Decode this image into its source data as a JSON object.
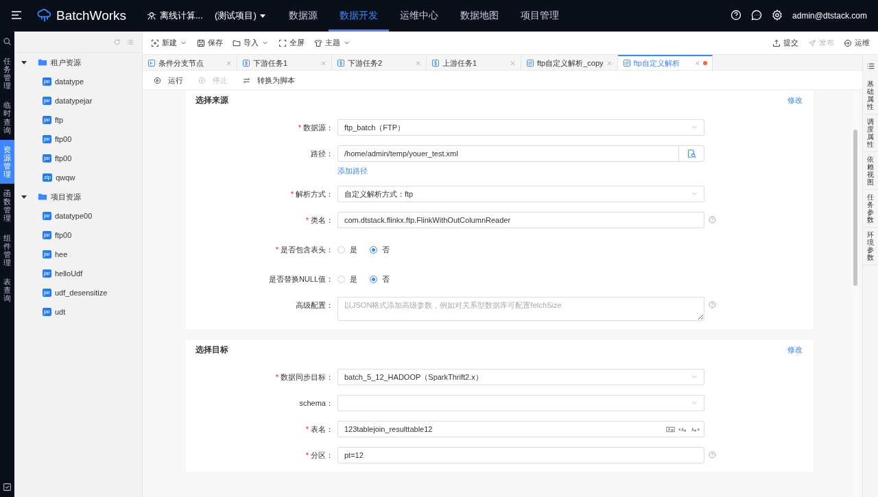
{
  "header": {
    "brand": "BatchWorks",
    "project": "离线计算...",
    "project_tag": "(测试项目)",
    "nav": [
      {
        "label": "数据源",
        "selected": false
      },
      {
        "label": "数据开发",
        "selected": true
      },
      {
        "label": "运维中心",
        "selected": false
      },
      {
        "label": "数据地图",
        "selected": false
      },
      {
        "label": "项目管理",
        "selected": false
      }
    ],
    "user": "admin@dtstack.com"
  },
  "rail": {
    "items": [
      {
        "label": "任务管理",
        "selected": false
      },
      {
        "label": "临时查询",
        "selected": false
      },
      {
        "label": "资源管理",
        "selected": true
      },
      {
        "label": "函数管理",
        "selected": false
      },
      {
        "label": "组件管理",
        "selected": false
      },
      {
        "label": "表查询",
        "selected": false
      }
    ]
  },
  "tree": [
    {
      "label": "租户资源",
      "expanded": true,
      "children": [
        {
          "label": "datatype",
          "badge": "jar"
        },
        {
          "label": "datatypejar",
          "badge": "jar"
        },
        {
          "label": "ftp",
          "badge": "jar"
        },
        {
          "label": "ftp00",
          "badge": "jar"
        },
        {
          "label": "ftp00",
          "badge": "jar"
        },
        {
          "label": "qwqw",
          "badge": "zip"
        }
      ]
    },
    {
      "label": "项目资源",
      "expanded": true,
      "children": [
        {
          "label": "datatype00",
          "badge": "jar"
        },
        {
          "label": "ftp00",
          "badge": "jar"
        },
        {
          "label": "hee",
          "badge": "jar"
        },
        {
          "label": "helloUdf",
          "badge": "jar"
        },
        {
          "label": "udf_desensitize",
          "badge": "jar"
        },
        {
          "label": "udt",
          "badge": "jar"
        }
      ]
    }
  ],
  "toolbar": {
    "left": [
      {
        "label": "新建",
        "kind": "new",
        "dropdown": true,
        "disabled": false
      },
      {
        "label": "保存",
        "kind": "save",
        "dropdown": false,
        "disabled": false
      },
      {
        "label": "导入",
        "kind": "import",
        "dropdown": true,
        "disabled": false
      },
      {
        "label": "全屏",
        "kind": "fullscreen",
        "dropdown": false,
        "disabled": false
      },
      {
        "label": "主题",
        "kind": "theme",
        "dropdown": true,
        "disabled": false
      }
    ],
    "right": [
      {
        "label": "提交",
        "kind": "submit",
        "dropdown": false,
        "disabled": false
      },
      {
        "label": "发布",
        "kind": "publish",
        "dropdown": false,
        "disabled": true
      },
      {
        "label": "运维",
        "kind": "ops",
        "dropdown": false,
        "disabled": false
      }
    ]
  },
  "tabs": [
    {
      "label": "条件分支节点",
      "kind": "branch",
      "selected": false,
      "modified": false
    },
    {
      "label": "下游任务1",
      "kind": "sql",
      "selected": false,
      "modified": false
    },
    {
      "label": "下游任务2",
      "kind": "sql",
      "selected": false,
      "modified": false
    },
    {
      "label": "上游任务1",
      "kind": "sql",
      "selected": false,
      "modified": false
    },
    {
      "label": "ftp自定义解析_copy",
      "kind": "sync",
      "selected": false,
      "modified": false
    },
    {
      "label": "ftp自定义解析",
      "kind": "sync",
      "selected": true,
      "modified": true
    }
  ],
  "runbar": [
    {
      "label": "运行",
      "kind": "run",
      "disabled": false
    },
    {
      "label": "停止",
      "kind": "stop",
      "disabled": true
    },
    {
      "label": "转换为脚本",
      "kind": "convert",
      "disabled": false
    }
  ],
  "side_tabs": [
    "基础属性",
    "调度属性",
    "依赖视图",
    "任务参数",
    "环境参数"
  ],
  "sections": [
    {
      "title": "选择来源",
      "action": "修改",
      "fields": [
        {
          "label": "数据源：",
          "required": "*",
          "kind": "select",
          "value": "ftp_batch（FTP）",
          "help": false
        },
        {
          "label": "路径：",
          "kind": "path",
          "value": "/home/admin/temp/youer_test.xml",
          "link": "添加路径",
          "help": false
        },
        {
          "label": "解析方式：",
          "required": "*",
          "kind": "select",
          "value": "自定义解析方式：ftp",
          "help": false
        },
        {
          "label": "类名：",
          "required": "*",
          "kind": "input",
          "value": "com.dtstack.flinkx.ftp.FlinkWithOutColumnReader",
          "help": true
        },
        {
          "label": "是否包含表头：",
          "required": "*",
          "kind": "radio",
          "options": [
            {
              "label": "是",
              "selected": false
            },
            {
              "label": "否",
              "selected": true
            }
          ],
          "help": false
        },
        {
          "label": "是否替换NULL值：",
          "kind": "radio",
          "options": [
            {
              "label": "是",
              "selected": false
            },
            {
              "label": "否",
              "selected": true
            }
          ],
          "help": false
        },
        {
          "label": "高级配置：",
          "kind": "textarea",
          "placeholder": "以JSON格式添加高级参数，例如对关系型数据库可配置fetchSize",
          "help": true
        }
      ]
    },
    {
      "title": "选择目标",
      "action": "修改",
      "fields": [
        {
          "label": "数据同步目标：",
          "required": "*",
          "kind": "select",
          "value": "batch_5_12_HADOOP（SparkThrift2.x）",
          "help": false
        },
        {
          "label": "schema：",
          "kind": "select",
          "help": false
        },
        {
          "label": "表名：",
          "required": "*",
          "kind": "case",
          "value": "123tablejoin_resulttable12",
          "help": false
        },
        {
          "label": "分区：",
          "required": "*",
          "kind": "input",
          "value": "pt=12",
          "help": true
        }
      ]
    }
  ]
}
